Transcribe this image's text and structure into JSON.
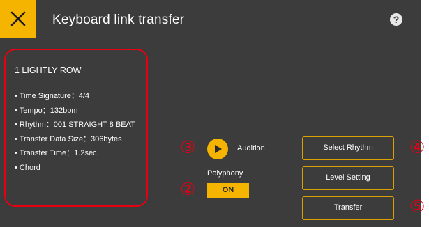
{
  "header": {
    "title": "Keyboard link transfer",
    "close_icon": "close-icon",
    "help_label": "?"
  },
  "song": {
    "title": "1 LIGHTLY ROW",
    "details": [
      "• Time Signature：4/4",
      "• Tempo：132bpm",
      "• Rhythm：001 STRAIGHT 8 BEAT",
      "• Transfer Data Size：306bytes",
      "• Transfer Time：1.2sec",
      "• Chord"
    ]
  },
  "controls": {
    "audition_label": "Audition",
    "polyphony_label": "Polyphony",
    "polyphony_value": "ON",
    "select_rhythm": "Select Rhythm",
    "level_setting": "Level Setting",
    "transfer": "Transfer"
  },
  "markers": {
    "m2": "②",
    "m3": "③",
    "m4": "④",
    "m5": "⑤"
  },
  "colors": {
    "accent": "#f5b400",
    "background": "#3c3c3c",
    "annotation": "#e60012"
  }
}
